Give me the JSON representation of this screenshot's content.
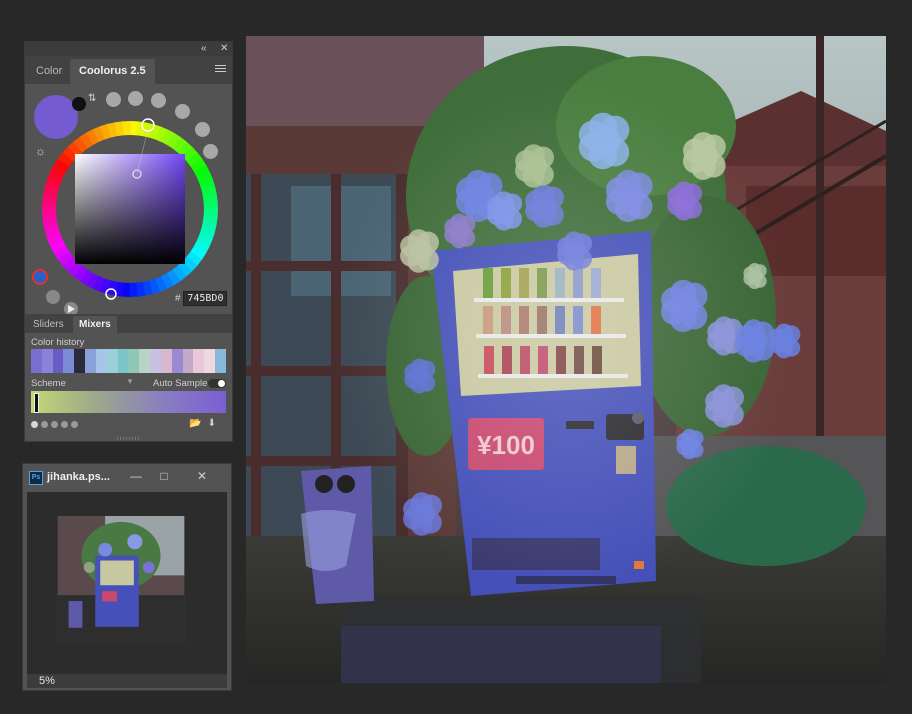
{
  "coolorus_panel": {
    "tabs": [
      {
        "label": "Color",
        "active": false
      },
      {
        "label": "Coolorus 2.5",
        "active": true
      }
    ],
    "current_color_hex": "745BD0",
    "hex_prefix": "#",
    "subtabs": [
      {
        "label": "Sliders",
        "active": false
      },
      {
        "label": "Mixers",
        "active": true
      }
    ],
    "color_history_label": "Color history",
    "scheme_label": "Scheme",
    "auto_sample_label": "Auto Sample",
    "auto_sample_on": true,
    "color_history": [
      "#7a6fd0",
      "#8a84d8",
      "#6a5cc6",
      "#7c8ad8",
      "#2a2a3a",
      "#8aa0d8",
      "#a8c4e8",
      "#9ad0d8",
      "#7cc4c8",
      "#8ec6b8",
      "#b8d4c4",
      "#c8c0e0",
      "#d8b8d0",
      "#9a8ad0",
      "#c4a8c8",
      "#e8c8d8",
      "#f0d8e0",
      "#8ab8d8"
    ],
    "accent_color": "#745BD0"
  },
  "navigator_panel": {
    "doc_title": "jihanka.ps...",
    "zoom_label": "5%"
  },
  "icons": [
    "collapse-icon",
    "close-icon",
    "panel-menu-icon",
    "swap-colors-icon",
    "color-mode-icon",
    "brightness-icon",
    "harmony-icon",
    "triad-icon",
    "play-icon",
    "folder-icon",
    "save-icon",
    "minimize-icon",
    "maximize-icon"
  ]
}
